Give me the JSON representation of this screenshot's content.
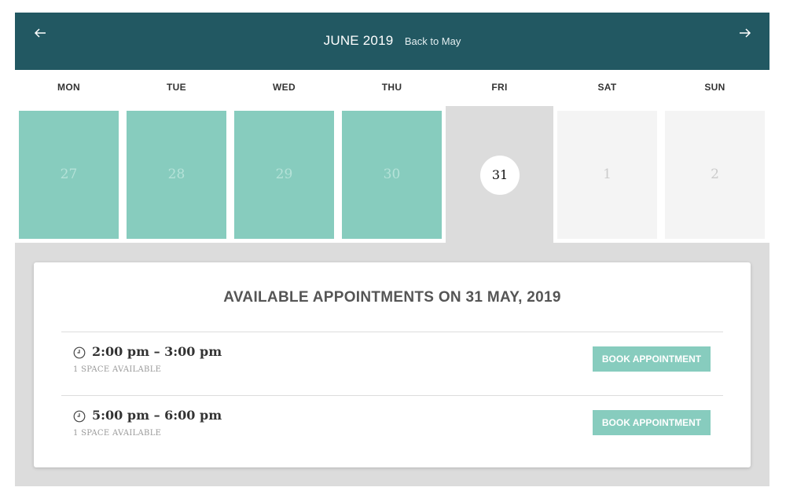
{
  "header": {
    "month_title": "JUNE 2019",
    "back_label": "Back to May",
    "prev_icon": "arrow-left-icon",
    "next_icon": "arrow-right-icon",
    "background_color": "#225862"
  },
  "weekdays": [
    "MON",
    "TUE",
    "WED",
    "THU",
    "FRI",
    "SAT",
    "SUN"
  ],
  "days": [
    {
      "label": "27",
      "state": "past"
    },
    {
      "label": "28",
      "state": "past"
    },
    {
      "label": "29",
      "state": "past"
    },
    {
      "label": "30",
      "state": "past"
    },
    {
      "label": "31",
      "state": "selected"
    },
    {
      "label": "1",
      "state": "future"
    },
    {
      "label": "2",
      "state": "future"
    }
  ],
  "appointments": {
    "title": "AVAILABLE APPOINTMENTS ON 31 MAY, 2019",
    "slots": [
      {
        "time": "2:00 pm – 3:00 pm",
        "availability": "1 SPACE AVAILABLE",
        "button": "BOOK APPOINTMENT"
      },
      {
        "time": "5:00 pm – 6:00 pm",
        "availability": "1 SPACE AVAILABLE",
        "button": "BOOK APPOINTMENT"
      }
    ]
  },
  "colors": {
    "accent": "#87ccbe",
    "selected_bg": "#dcdcdc",
    "future_bg": "#f4f4f4"
  }
}
